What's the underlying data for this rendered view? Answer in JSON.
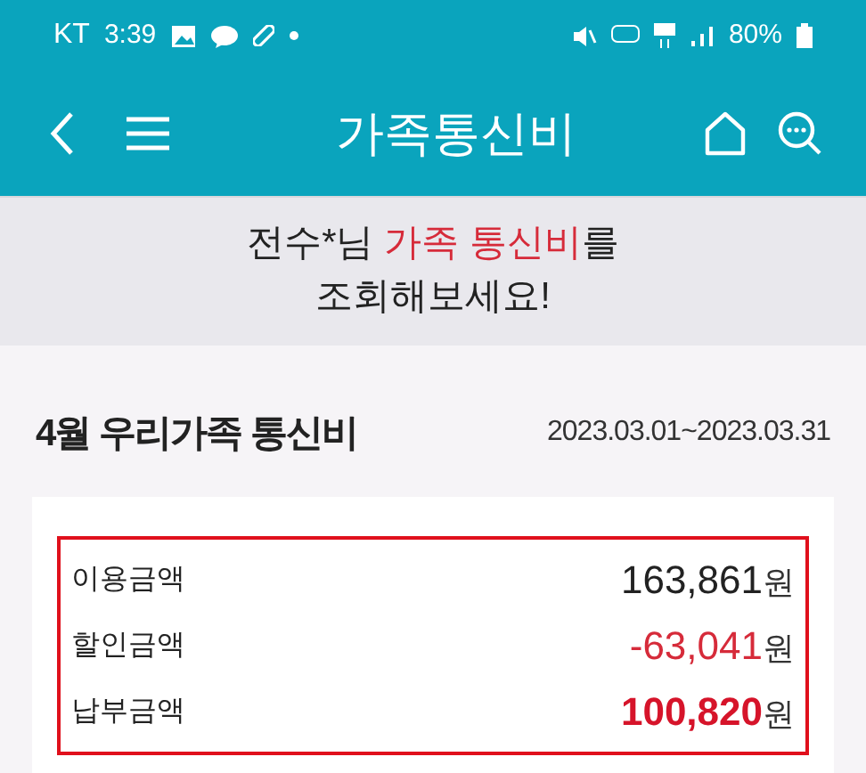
{
  "status_bar": {
    "carrier": "KT",
    "time": "3:39",
    "battery": "80%"
  },
  "header": {
    "title": "가족통신비"
  },
  "banner": {
    "before": "전수*님 ",
    "highlight": "가족 통신비",
    "after": "를",
    "line2": "조회해보세요!"
  },
  "section": {
    "title": "4월 우리가족 통신비",
    "period": "2023.03.01~2023.03.31"
  },
  "rows": [
    {
      "kind": "usage",
      "label": "이용금액",
      "amount": "163,861",
      "unit": "원"
    },
    {
      "kind": "discount",
      "label": "할인금액",
      "amount": "-63,041",
      "unit": "원"
    },
    {
      "kind": "total",
      "label": "납부금액",
      "amount": "100,820",
      "unit": "원"
    }
  ]
}
